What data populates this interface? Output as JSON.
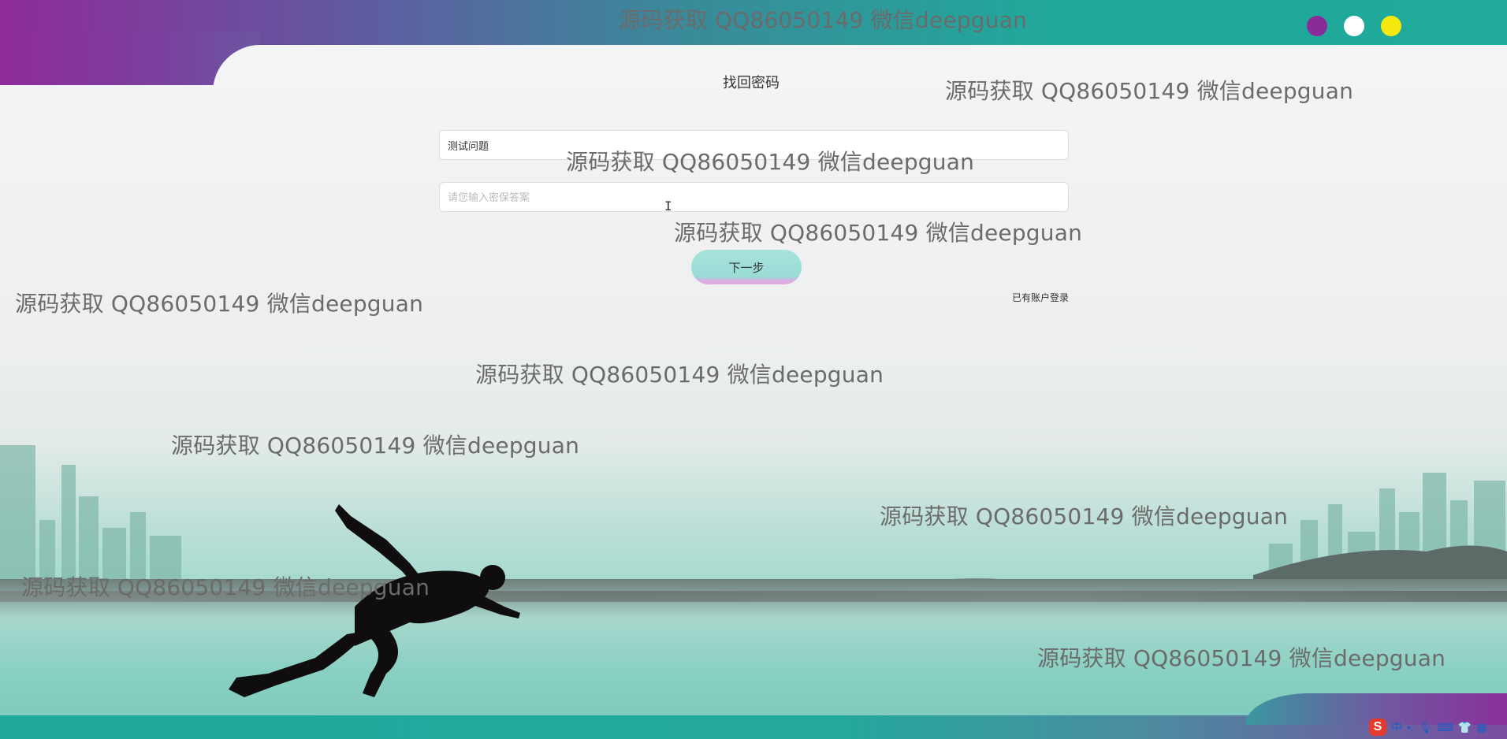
{
  "page": {
    "title": "找回密码"
  },
  "form": {
    "question_value": "测试问题",
    "answer_placeholder": "请您输入密保答案",
    "next_label": "下一步",
    "login_link": "已有账户登录"
  },
  "watermarks": [
    "源码获取 QQ86050149 微信deepguan",
    "源码获取 QQ86050149 微信deepguan",
    "源码获取 QQ86050149 微信deepguan",
    "源码获取 QQ86050149 微信deepguan",
    "源码获取 QQ86050149 微信deepguan",
    "源码获取 QQ86050149 微信deepguan",
    "源码获取 QQ86050149 微信deepguan",
    "源码获取 QQ86050149 微信deepguan",
    "源码获取 QQ86050149 微信deepguan",
    "源码获取 QQ86050149 微信deepguan"
  ],
  "colors": {
    "dot1": "#8b2b9a",
    "dot2": "#ffffff",
    "dot3": "#f4e80f",
    "accent": "#1faa9c",
    "brand_purple": "#8e2a9a"
  },
  "tray": {
    "ime_logo": "S",
    "ime_lang": "中",
    "icons": [
      "punctuation-icon",
      "microphone-icon",
      "keyboard-icon",
      "skin-icon",
      "toolbox-icon"
    ]
  }
}
